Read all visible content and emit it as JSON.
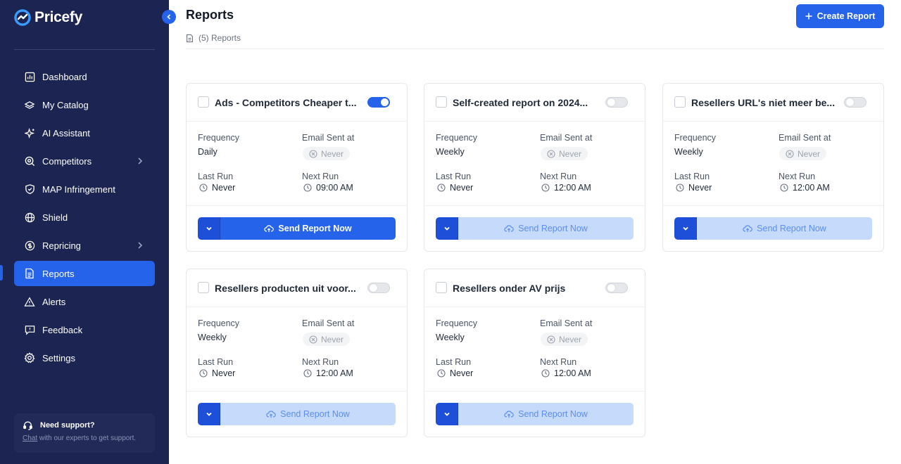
{
  "app": {
    "name": "Pricefy"
  },
  "sidebar": {
    "items": [
      {
        "label": "Dashboard",
        "icon": "dashboard-icon"
      },
      {
        "label": "My Catalog",
        "icon": "catalog-icon"
      },
      {
        "label": "AI Assistant",
        "icon": "sparkle-icon"
      },
      {
        "label": "Competitors",
        "icon": "search-icon"
      },
      {
        "label": "MAP Infringement",
        "icon": "shield-check-icon"
      },
      {
        "label": "Shield",
        "icon": "globe-icon"
      },
      {
        "label": "Repricing",
        "icon": "repricing-icon"
      },
      {
        "label": "Reports",
        "icon": "document-icon"
      },
      {
        "label": "Alerts",
        "icon": "warning-icon"
      },
      {
        "label": "Feedback",
        "icon": "feedback-icon"
      },
      {
        "label": "Settings",
        "icon": "gear-icon"
      }
    ],
    "active": "Reports",
    "support": {
      "title": "Need support?",
      "link": "Chat",
      "text": " with our experts to get support."
    }
  },
  "header": {
    "title": "Reports",
    "subtitle": "(5) Reports",
    "create_label": "Create Report"
  },
  "labels": {
    "frequency": "Frequency",
    "email_sent": "Email Sent at",
    "last_run": "Last Run",
    "next_run": "Next Run",
    "send": "Send Report Now"
  },
  "reports": [
    {
      "title": "Ads - Competitors Cheaper t...",
      "enabled": true,
      "frequency": "Daily",
      "email_sent": "Never",
      "last_run": "Never",
      "next_run": "09:00 AM"
    },
    {
      "title": "Self-created report on 2024...",
      "enabled": false,
      "frequency": "Weekly",
      "email_sent": "Never",
      "last_run": "Never",
      "next_run": "12:00 AM"
    },
    {
      "title": "Resellers URL's niet meer be...",
      "enabled": false,
      "frequency": "Weekly",
      "email_sent": "Never",
      "last_run": "Never",
      "next_run": "12:00 AM"
    },
    {
      "title": "Resellers producten uit voor...",
      "enabled": false,
      "frequency": "Weekly",
      "email_sent": "Never",
      "last_run": "Never",
      "next_run": "12:00 AM"
    },
    {
      "title": "Resellers onder AV prijs",
      "enabled": false,
      "frequency": "Weekly",
      "email_sent": "Never",
      "last_run": "Never",
      "next_run": "12:00 AM"
    }
  ],
  "colors": {
    "sidebar_bg": "#1c2452",
    "accent": "#2563eb",
    "disabled_button": "#c6dafb"
  }
}
